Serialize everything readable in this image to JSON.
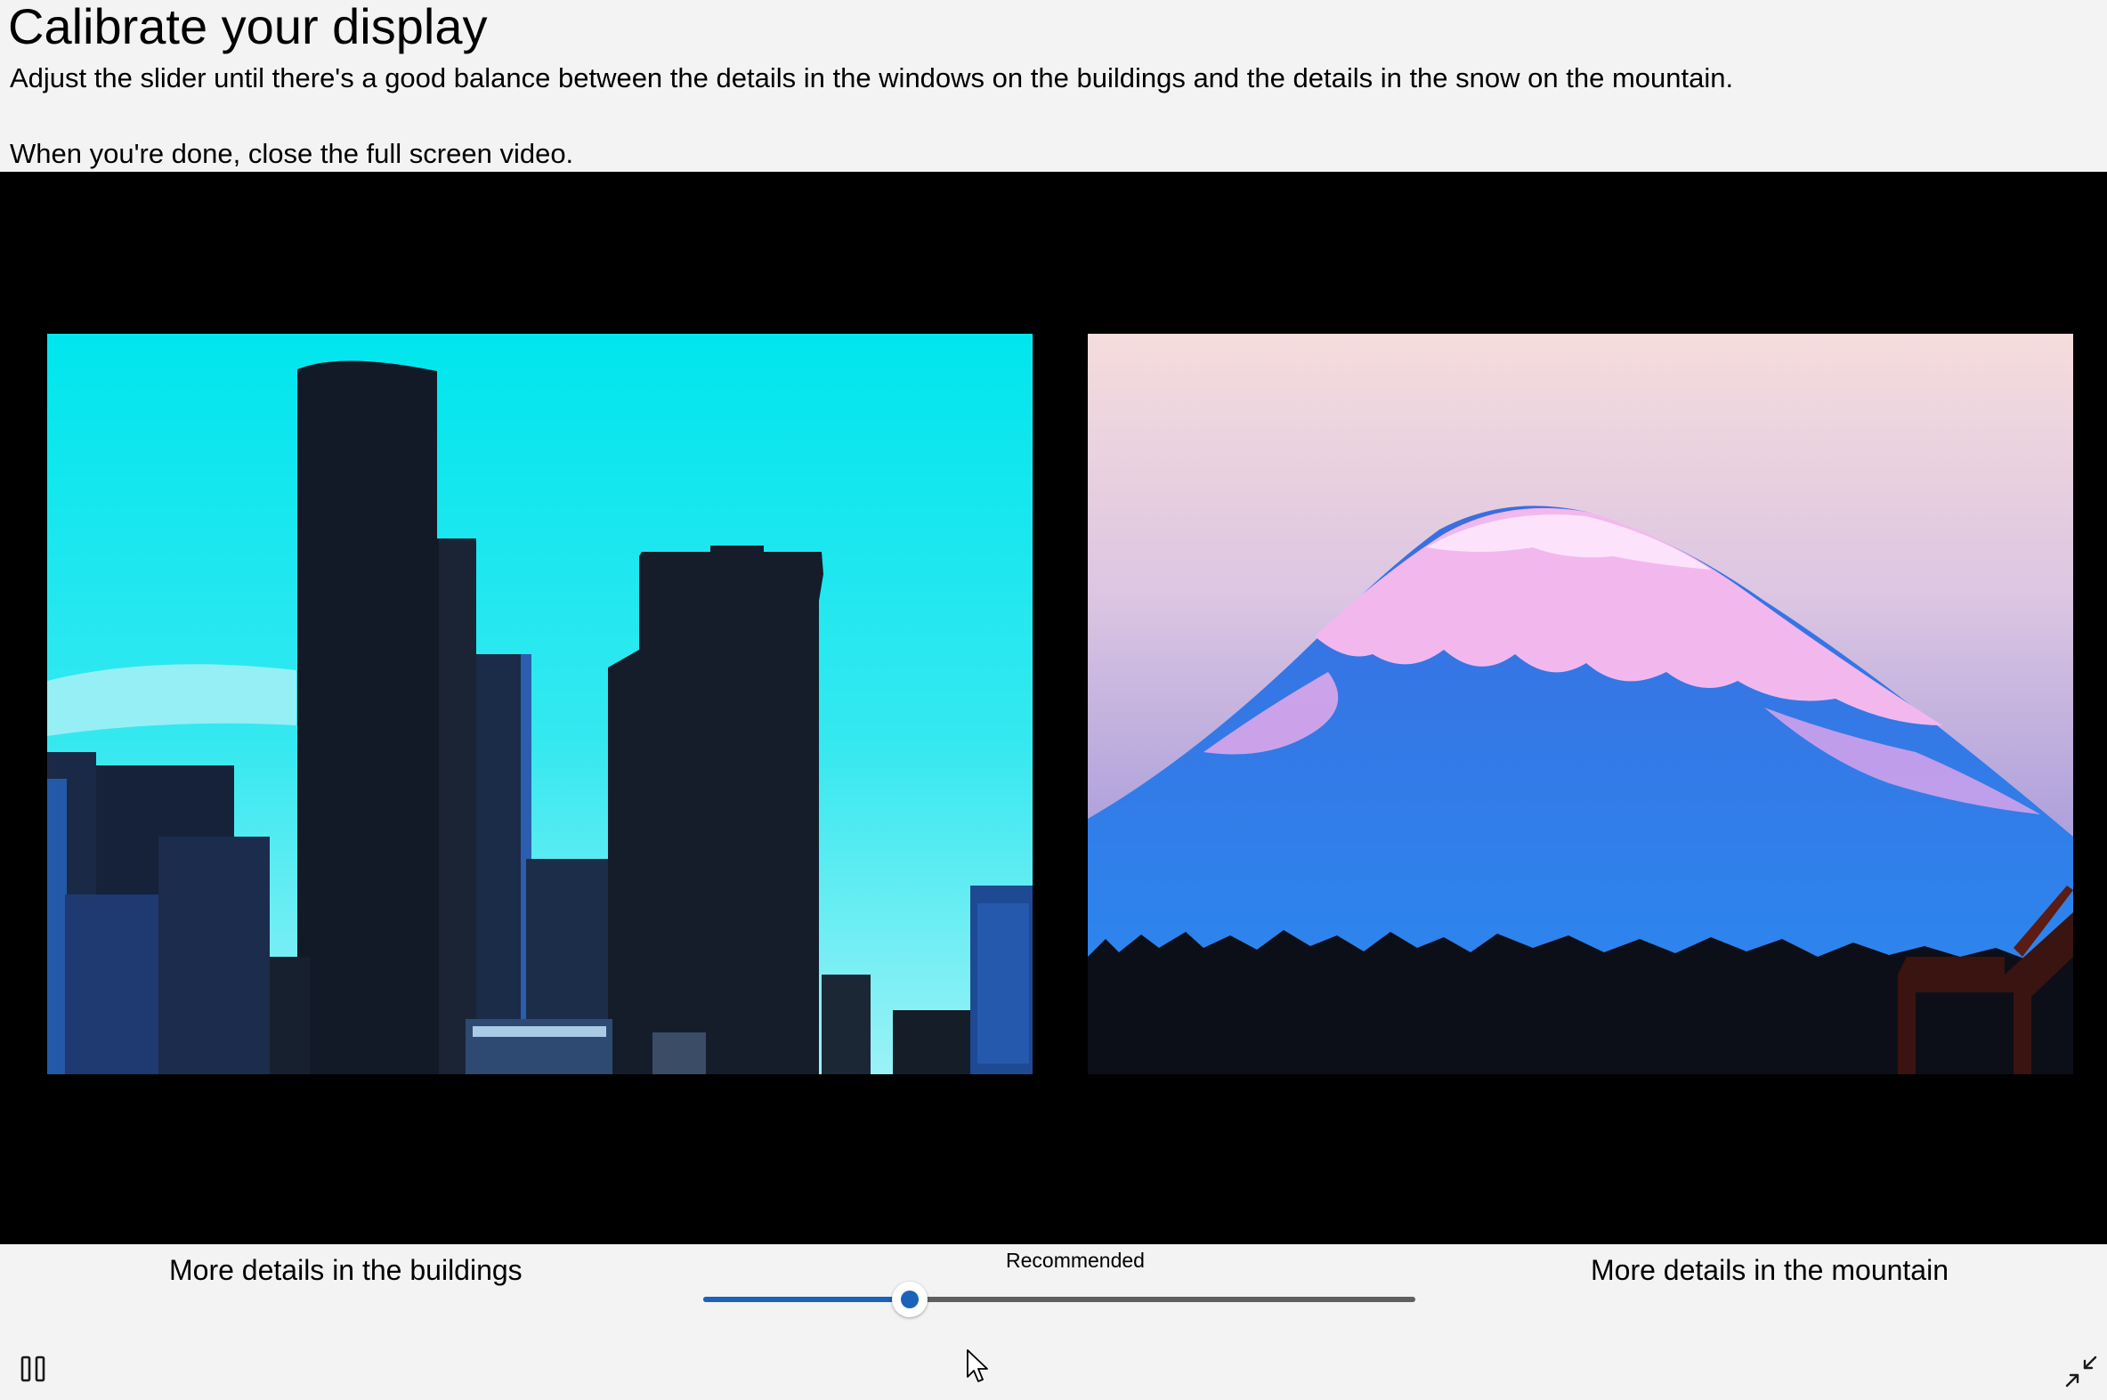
{
  "header": {
    "title": "Calibrate your display",
    "instruction_1": "Adjust the slider until there's a good balance between the details in the windows on the buildings and the details in the snow on the mountain.",
    "instruction_2": "When you're done, close the full screen video."
  },
  "video": {
    "left_image": "city-buildings-image",
    "right_image": "snow-mountain-image"
  },
  "controls": {
    "left_label": "More details in the buildings",
    "right_label": "More details in the mountain",
    "recommended_label": "Recommended",
    "slider": {
      "value_fraction": 0.29,
      "fill_color": "#1a63b8",
      "track_color": "#5f5f5f"
    },
    "pause_icon": "pause-icon",
    "exit_fullscreen_icon": "exit-fullscreen-icon"
  }
}
